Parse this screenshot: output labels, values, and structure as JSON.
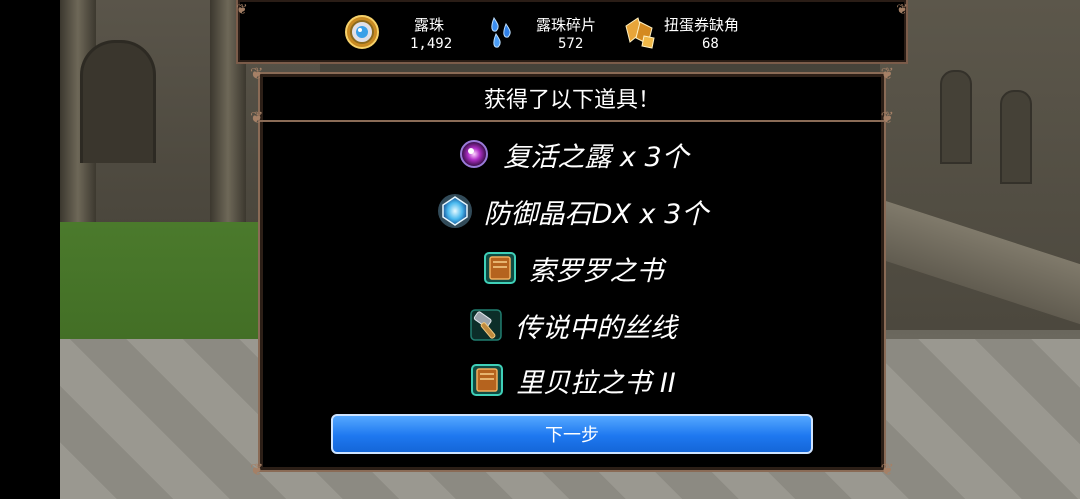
{
  "currency": [
    {
      "label": "露珠",
      "value": "1,492",
      "icon": "dew-orb-icon"
    },
    {
      "label": "露珠碎片",
      "value": "572",
      "icon": "dew-shard-icon"
    },
    {
      "label": "扭蛋券缺角",
      "value": "68",
      "icon": "gacha-ticket-fragment-icon"
    }
  ],
  "dialog": {
    "title": "获得了以下道具！",
    "items": [
      {
        "name": "复活之露 x 3个",
        "icon": "revival-dew-icon"
      },
      {
        "name": "防御晶石DX x 3个",
        "icon": "defense-crystal-icon"
      },
      {
        "name": "索罗罗之书",
        "icon": "book-icon"
      },
      {
        "name": "传说中的丝线",
        "icon": "hammer-icon"
      },
      {
        "name": "里贝拉之书 II",
        "icon": "book-icon"
      }
    ],
    "next_label": "下一步"
  },
  "colors": {
    "frame": "#8a6b56",
    "button": "#1e78f0",
    "background": "#000000"
  }
}
